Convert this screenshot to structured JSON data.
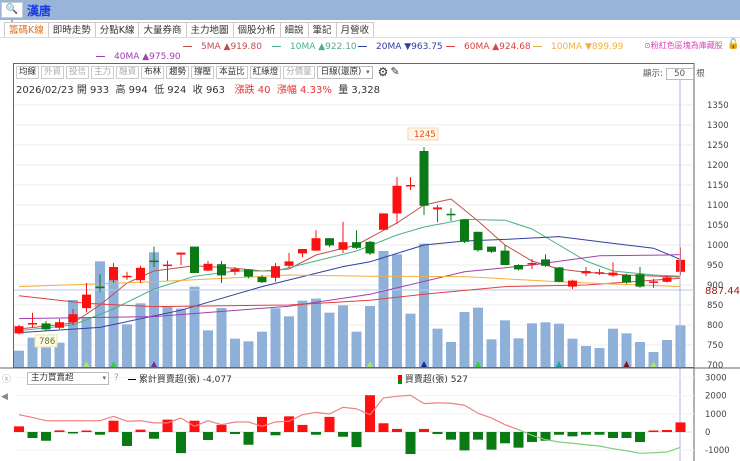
{
  "header": {
    "search_icon": "🔍+",
    "title": "漢唐"
  },
  "tabs": [
    {
      "label": "籌碼K線",
      "active": true
    },
    {
      "label": "即時走勢"
    },
    {
      "label": "分點K線"
    },
    {
      "label": "大量券商"
    },
    {
      "label": "主力地圖"
    },
    {
      "label": "個股分析"
    },
    {
      "label": "細說"
    },
    {
      "label": "筆記"
    },
    {
      "label": "月營收"
    }
  ],
  "ma_legend": [
    {
      "label": "5MA",
      "arrow": "▲",
      "value": "919.80",
      "color": "#c0504d"
    },
    {
      "label": "10MA",
      "arrow": "▲",
      "value": "922.10",
      "color": "#4cb08a"
    },
    {
      "label": "20MA",
      "arrow": "▼",
      "value": "963.75",
      "color": "#3040a0"
    },
    {
      "label": "60MA",
      "arrow": "▲",
      "value": "924.68",
      "color": "#e04040"
    },
    {
      "label": "100MA",
      "arrow": "▼",
      "value": "899.99",
      "color": "#f0b040"
    },
    {
      "label": "40MA",
      "arrow": "▲",
      "value": "975.90",
      "color": "#a040b0"
    }
  ],
  "treasury_note": "粉紅色區塊為庫藏股",
  "toolbar": {
    "buttons": [
      {
        "label": "均線"
      },
      {
        "label": "外資",
        "disabled": true
      },
      {
        "label": "投信",
        "disabled": true
      },
      {
        "label": "主力",
        "disabled": true
      },
      {
        "label": "融資",
        "disabled": true
      },
      {
        "label": "布林"
      },
      {
        "label": "趨勢"
      },
      {
        "label": "撐壓"
      },
      {
        "label": "本益比"
      },
      {
        "label": "紅綠燈"
      },
      {
        "label": "分價量",
        "disabled": true
      }
    ],
    "period": "日線(還原)",
    "display_label": "顯示:",
    "display_count": "50",
    "display_unit": "根"
  },
  "quote": {
    "date": "2026/02/23",
    "open_label": "開",
    "open": "933",
    "high_label": "高",
    "high": "994",
    "low_label": "低",
    "low": "924",
    "close_label": "收",
    "close": "963",
    "change_label": "漲跌",
    "change": "40",
    "pct_label": "漲幅",
    "pct": "4.33%",
    "vol_label": "量",
    "volume": "3,328"
  },
  "colors": {
    "up": "#ff1010",
    "down": "#0a7a14",
    "volume": "#8fb0d8"
  },
  "chart_data": [
    {
      "type": "candlestick",
      "ylim": [
        700,
        1350
      ],
      "yticks": [
        700,
        750,
        800,
        850,
        900,
        950,
        1000,
        1050,
        1100,
        1150,
        1200,
        1250,
        1300,
        1350
      ],
      "max_label": "1245",
      "min_label": "786",
      "ref_price": "887.44",
      "ohlc": [
        [
          779,
          800,
          776,
          797
        ],
        [
          804,
          831,
          794,
          805
        ],
        [
          804,
          810,
          785,
          789
        ],
        [
          793,
          815,
          790,
          807
        ],
        [
          807,
          840,
          800,
          827
        ],
        [
          842,
          905,
          832,
          876
        ],
        [
          896,
          927,
          883,
          893
        ],
        [
          912,
          955,
          905,
          945
        ],
        [
          922,
          933,
          913,
          923
        ],
        [
          912,
          948,
          905,
          943
        ],
        [
          961,
          996,
          945,
          958
        ],
        [
          950,
          961,
          911,
          951
        ],
        [
          976,
          981,
          950,
          981
        ],
        [
          996,
          996,
          930,
          930
        ],
        [
          936,
          960,
          935,
          953
        ],
        [
          952,
          960,
          905,
          924
        ],
        [
          933,
          945,
          925,
          940
        ],
        [
          939,
          940,
          917,
          921
        ],
        [
          920,
          925,
          905,
          907
        ],
        [
          918,
          955,
          908,
          947
        ],
        [
          948,
          980,
          944,
          959
        ],
        [
          979,
          990,
          970,
          990
        ],
        [
          986,
          1037,
          985,
          1017
        ],
        [
          1017,
          1017,
          995,
          999
        ],
        [
          988,
          1058,
          980,
          1007
        ],
        [
          1007,
          1037,
          990,
          993
        ],
        [
          1008,
          1010,
          975,
          979
        ],
        [
          1038,
          1079,
          1037,
          1079
        ],
        [
          1079,
          1170,
          1053,
          1148
        ],
        [
          1149,
          1170,
          1137,
          1150
        ],
        [
          1235,
          1245,
          1075,
          1098
        ],
        [
          1089,
          1100,
          1057,
          1094
        ],
        [
          1078,
          1092,
          1060,
          1077
        ],
        [
          1064,
          1064,
          1005,
          1008
        ],
        [
          1033,
          1033,
          983,
          987
        ],
        [
          996,
          996,
          980,
          983
        ],
        [
          986,
          1000,
          950,
          950
        ],
        [
          950,
          952,
          937,
          939
        ],
        [
          954,
          965,
          940,
          955
        ],
        [
          964,
          977,
          945,
          948
        ],
        [
          944,
          945,
          907,
          908
        ],
        [
          896,
          913,
          890,
          911
        ],
        [
          929,
          945,
          922,
          935
        ],
        [
          931,
          940,
          925,
          932
        ],
        [
          924,
          957,
          920,
          931
        ],
        [
          925,
          928,
          903,
          906
        ],
        [
          927,
          945,
          893,
          896
        ],
        [
          908,
          915,
          893,
          909
        ],
        [
          908,
          923,
          906,
          919
        ],
        [
          933,
          994,
          924,
          963
        ]
      ],
      "volume": [
        1306,
        2346,
        2293,
        1947,
        5360,
        3973,
        8453,
        7013,
        3413,
        5093,
        9173,
        4827,
        4667,
        6427,
        2933,
        4720,
        2267,
        2053,
        2827,
        4693,
        4053,
        5307,
        5467,
        4347,
        4933,
        2827,
        4880,
        9280,
        9013,
        4267,
        9867,
        3067,
        2000,
        4400,
        4747,
        2213,
        3733,
        2293,
        3493,
        3573,
        3467,
        2267,
        1680,
        1520,
        3067,
        2693,
        2000,
        1200,
        2160,
        3328
      ],
      "ma": [
        {
          "name": "5MA",
          "color": "#c0504d",
          "points": [
            [
              0,
              790
            ],
            [
              4,
              805
            ],
            [
              6,
              850
            ],
            [
              8,
              905
            ],
            [
              10,
              935
            ],
            [
              13,
              948
            ],
            [
              16,
              942
            ],
            [
              18,
              935
            ],
            [
              20,
              940
            ],
            [
              22,
              975
            ],
            [
              25,
              1000
            ],
            [
              28,
              1055
            ],
            [
              30,
              1100
            ],
            [
              32,
              1115
            ],
            [
              34,
              1060
            ],
            [
              36,
              1000
            ],
            [
              38,
              960
            ],
            [
              40,
              940
            ],
            [
              42,
              932
            ],
            [
              45,
              925
            ],
            [
              49,
              920
            ]
          ]
        },
        {
          "name": "10MA",
          "color": "#4cb08a",
          "points": [
            [
              0,
              786
            ],
            [
              4,
              800
            ],
            [
              7,
              840
            ],
            [
              10,
              890
            ],
            [
              13,
              922
            ],
            [
              16,
              935
            ],
            [
              19,
              935
            ],
            [
              22,
              960
            ],
            [
              25,
              985
            ],
            [
              28,
              1025
            ],
            [
              30,
              1045
            ],
            [
              33,
              1064
            ],
            [
              36,
              1062
            ],
            [
              38,
              1040
            ],
            [
              40,
              1000
            ],
            [
              42,
              960
            ],
            [
              44,
              935
            ],
            [
              47,
              925
            ],
            [
              49,
              922
            ]
          ]
        },
        {
          "name": "20MA",
          "color": "#3040a0",
          "points": [
            [
              0,
              781
            ],
            [
              6,
              794
            ],
            [
              12,
              837
            ],
            [
              18,
              896
            ],
            [
              24,
              946
            ],
            [
              26,
              958
            ],
            [
              30,
              1000
            ],
            [
              33,
              1010
            ],
            [
              36,
              1014
            ],
            [
              40,
              1021
            ],
            [
              44,
              1004
            ],
            [
              47,
              992
            ],
            [
              49,
              964
            ]
          ]
        },
        {
          "name": "40MA",
          "color": "#a040b0",
          "points": [
            [
              0,
              816
            ],
            [
              10,
              821
            ],
            [
              20,
              847
            ],
            [
              26,
              877
            ],
            [
              33,
              933
            ],
            [
              38,
              950
            ],
            [
              43,
              973
            ],
            [
              48,
              975
            ],
            [
              49,
              976
            ]
          ]
        },
        {
          "name": "60MA",
          "color": "#e04040",
          "points": [
            [
              0,
              873
            ],
            [
              5,
              854
            ],
            [
              10,
              846
            ],
            [
              20,
              850
            ],
            [
              26,
              862
            ],
            [
              30,
              877
            ],
            [
              36,
              896
            ],
            [
              42,
              900
            ],
            [
              49,
              917
            ]
          ]
        },
        {
          "name": "100MA",
          "color": "#f0b040",
          "points": [
            [
              0,
              896
            ],
            [
              10,
              908
            ],
            [
              20,
              925
            ],
            [
              26,
              922
            ],
            [
              33,
              921
            ],
            [
              40,
              908
            ],
            [
              49,
              896
            ]
          ]
        }
      ],
      "signals": [
        {
          "i": 5,
          "color": "#a8e870"
        },
        {
          "i": 7,
          "color": "#30d040"
        },
        {
          "i": 10,
          "color": "#7030a0"
        },
        {
          "i": 26,
          "color": "#a8e870"
        },
        {
          "i": 30,
          "color": "#102890"
        },
        {
          "i": 34,
          "color": "#30d040"
        },
        {
          "i": 40,
          "color": "#20a0a0"
        },
        {
          "i": 45,
          "color": "#801020"
        },
        {
          "i": 47,
          "color": "#a8e870"
        }
      ]
    },
    {
      "type": "bar+line",
      "indicator": "主力買賣超",
      "help": "?",
      "line_label": "累計買賣超(張)",
      "line_value": "-4,077",
      "bar_label": "買賣超(張)",
      "bar_value": "527",
      "ylim": [
        -1300,
        3300
      ],
      "yticks": [
        3000,
        2000,
        1000,
        0,
        -1000
      ],
      "bars": [
        310,
        -330,
        -480,
        90,
        -60,
        30,
        -150,
        620,
        -770,
        130,
        -370,
        680,
        -1160,
        620,
        -440,
        390,
        -110,
        -700,
        830,
        -180,
        860,
        390,
        -150,
        830,
        -260,
        -830,
        2020,
        480,
        170,
        -1210,
        170,
        -110,
        -420,
        -1010,
        -420,
        -970,
        -620,
        -860,
        -550,
        -480,
        -150,
        -240,
        -150,
        -150,
        -330,
        -330,
        -550,
        30,
        110,
        527
      ],
      "cumulative": [
        950,
        800,
        620,
        620,
        620,
        620,
        620,
        860,
        590,
        620,
        500,
        500,
        770,
        310,
        620,
        400,
        550,
        550,
        310,
        550,
        590,
        950,
        1080,
        990,
        1360,
        1270,
        950,
        1870,
        1960,
        2020,
        1560,
        1600,
        1580,
        1470,
        1030,
        770,
        400,
        130,
        -180,
        -420,
        -550,
        -620,
        -700,
        -770,
        -920,
        -1030,
        -1170,
        -1140,
        -1100,
        -840
      ]
    }
  ]
}
